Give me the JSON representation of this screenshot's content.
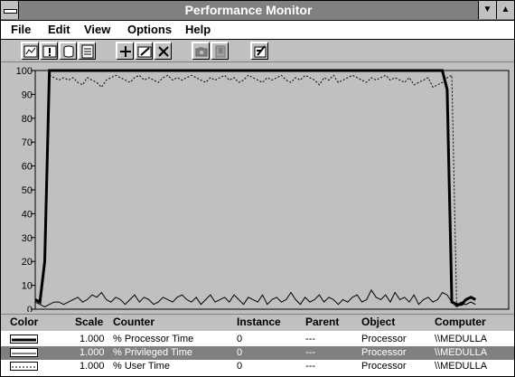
{
  "window": {
    "title": "Performance Monitor"
  },
  "menu": [
    "File",
    "Edit",
    "View",
    "Options",
    "Help"
  ],
  "toolbar": [
    "chart-view",
    "alert-view",
    "log-view",
    "report-view",
    "add-counter",
    "edit-counter",
    "delete-counter",
    "update-now",
    "bookmark",
    "options"
  ],
  "legend": {
    "headers": {
      "color": "Color",
      "scale": "Scale",
      "counter": "Counter",
      "instance": "Instance",
      "parent": "Parent",
      "object": "Object",
      "computer": "Computer"
    },
    "rows": [
      {
        "line": "thick-solid",
        "scale": "1.000",
        "counter": "% Processor Time",
        "instance": "0",
        "parent": "---",
        "object": "Processor",
        "computer": "\\\\MEDULLA",
        "selected": false
      },
      {
        "line": "thin-solid",
        "scale": "1.000",
        "counter": "% Privileged Time",
        "instance": "0",
        "parent": "---",
        "object": "Processor",
        "computer": "\\\\MEDULLA",
        "selected": true
      },
      {
        "line": "dashed",
        "scale": "1.000",
        "counter": "% User Time",
        "instance": "0",
        "parent": "---",
        "object": "Processor",
        "computer": "\\\\MEDULLA",
        "selected": false
      }
    ]
  },
  "colors": {
    "plot_bg": "#c0c0c0",
    "line": "#000000",
    "selection": "#808080"
  },
  "chart_data": {
    "type": "line",
    "ylim": [
      0,
      100
    ],
    "yticks": [
      0,
      10,
      20,
      30,
      40,
      50,
      60,
      70,
      80,
      90,
      100
    ],
    "grid": false,
    "legend": "bottom",
    "xlim": [
      0,
      100
    ],
    "series": [
      {
        "name": "% Processor Time",
        "style": "thick",
        "x": [
          0,
          1,
          2,
          3,
          4,
          86,
          87,
          88,
          89,
          90,
          91,
          92,
          93
        ],
        "y": [
          4,
          3,
          20,
          100,
          100,
          100,
          92,
          3,
          2,
          2,
          4,
          5,
          4
        ]
      },
      {
        "name": "% Privileged Time",
        "style": "thin",
        "x": [
          0,
          1,
          2,
          3,
          4,
          5,
          6,
          7,
          8,
          9,
          10,
          11,
          12,
          13,
          14,
          15,
          16,
          17,
          18,
          19,
          20,
          21,
          22,
          23,
          24,
          25,
          26,
          27,
          28,
          29,
          30,
          31,
          32,
          33,
          34,
          35,
          36,
          37,
          38,
          39,
          40,
          41,
          42,
          43,
          44,
          45,
          46,
          47,
          48,
          49,
          50,
          51,
          52,
          53,
          54,
          55,
          56,
          57,
          58,
          59,
          60,
          61,
          62,
          63,
          64,
          65,
          66,
          67,
          68,
          69,
          70,
          71,
          72,
          73,
          74,
          75,
          76,
          77,
          78,
          79,
          80,
          81,
          82,
          83,
          84,
          85,
          86,
          87,
          88,
          89,
          90,
          91,
          92,
          93
        ],
        "y": [
          3,
          2,
          1,
          2,
          3,
          3,
          2,
          3,
          4,
          5,
          3,
          4,
          6,
          5,
          7,
          4,
          3,
          5,
          4,
          2,
          4,
          6,
          3,
          5,
          4,
          2,
          3,
          5,
          4,
          3,
          5,
          6,
          4,
          3,
          5,
          2,
          4,
          6,
          3,
          4,
          5,
          3,
          6,
          4,
          2,
          5,
          4,
          3,
          6,
          2,
          4,
          5,
          3,
          4,
          7,
          4,
          2,
          5,
          3,
          4,
          6,
          3,
          5,
          4,
          2,
          4,
          3,
          5,
          6,
          3,
          4,
          8,
          5,
          4,
          6,
          3,
          7,
          4,
          5,
          3,
          6,
          2,
          4,
          5,
          3,
          4,
          7,
          6,
          3,
          1,
          2,
          2,
          3,
          2
        ]
      },
      {
        "name": "% User Time",
        "style": "dashed",
        "x": [
          3,
          4,
          5,
          6,
          7,
          8,
          9,
          10,
          11,
          12,
          13,
          14,
          15,
          16,
          17,
          18,
          19,
          20,
          21,
          22,
          23,
          24,
          25,
          26,
          27,
          28,
          29,
          30,
          31,
          32,
          33,
          34,
          35,
          36,
          37,
          38,
          39,
          40,
          41,
          42,
          43,
          44,
          45,
          46,
          47,
          48,
          49,
          50,
          51,
          52,
          53,
          54,
          55,
          56,
          57,
          58,
          59,
          60,
          61,
          62,
          63,
          64,
          65,
          66,
          67,
          68,
          69,
          70,
          71,
          72,
          73,
          74,
          75,
          76,
          77,
          78,
          79,
          80,
          81,
          82,
          83,
          84,
          85,
          86,
          87,
          88,
          89,
          90,
          91,
          92,
          93
        ],
        "y": [
          98,
          97,
          96,
          97,
          96,
          97,
          95,
          94,
          97,
          96,
          95,
          93,
          96,
          97,
          98,
          97,
          96,
          95,
          97,
          98,
          96,
          97,
          96,
          95,
          97,
          98,
          96,
          97,
          96,
          97,
          98,
          97,
          96,
          95,
          97,
          96,
          97,
          98,
          96,
          97,
          95,
          96,
          98,
          97,
          96,
          95,
          97,
          96,
          97,
          98,
          96,
          95,
          97,
          96,
          98,
          97,
          96,
          94,
          97,
          96,
          98,
          95,
          96,
          97,
          98,
          97,
          96,
          95,
          97,
          96,
          97,
          98,
          96,
          97,
          96,
          95,
          97,
          94,
          95,
          96,
          97,
          93,
          94,
          95,
          97,
          98,
          2,
          3,
          2,
          3,
          2
        ]
      }
    ]
  }
}
